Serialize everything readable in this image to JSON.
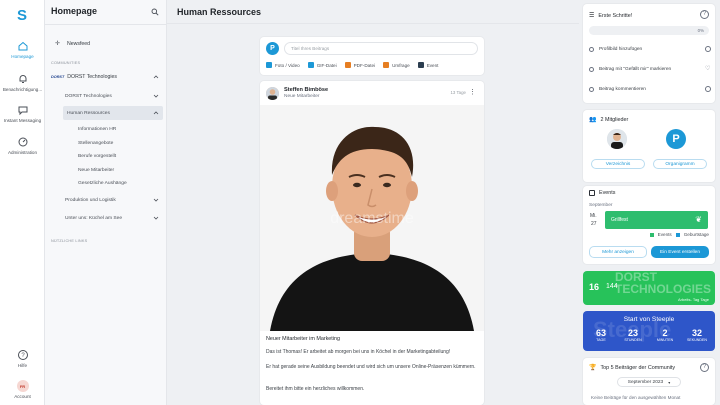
{
  "rail": {
    "logo": "S",
    "items": [
      {
        "label": "Homepage"
      },
      {
        "label": "Benachrichtigung..."
      },
      {
        "label": "Instant Messaging"
      },
      {
        "label": "Administration"
      }
    ],
    "help": "Hilfe",
    "account": "Account",
    "account_initials": "FR"
  },
  "sidebar": {
    "title": "Homepage",
    "newsfeed": "Newsfeed",
    "section_communities": "COMMUNITIES",
    "community_logo": "DORST",
    "community": "DORST Technologies",
    "items": [
      {
        "label": "DORST Technologies"
      },
      {
        "label": "Human Ressources"
      }
    ],
    "hr_children": [
      "Informationen HR",
      "Stellenangebote",
      "Berufe vorgestellt",
      "Neue Mitarbeiter",
      "Gesetzliche Aushänge"
    ],
    "more_items": [
      {
        "label": "Produktion und Logistik"
      },
      {
        "label": "Unter uns: Küchel am See"
      }
    ],
    "section_links": "NÜTZLICHE LINKS"
  },
  "header": {
    "title": "Human Ressources"
  },
  "composer": {
    "avatar": "P",
    "placeholder": "Titel Ihres Beitrags",
    "actions": [
      {
        "label": "Foto / Video",
        "color": "#1c98d6"
      },
      {
        "label": "GIF-Datei",
        "color": "#1c98d6"
      },
      {
        "label": "PDF-Datei",
        "color": "#e67e22"
      },
      {
        "label": "Umfrage",
        "color": "#e67e22"
      },
      {
        "label": "Event",
        "color": "#2c3e50"
      }
    ]
  },
  "post": {
    "author": "Steffen Bimböse",
    "role": "Neue Mitarbeiter",
    "time": "13 Tage",
    "watermark": "dreamstime",
    "title": "Neuer Mitarbeiter im Marketing",
    "lines": [
      "Das ist Thomas! Er arbeitet ab morgen bei uns in Köchel in der Marketingabteilung!",
      "Er hat gerade seine Ausbildung beendet und wird sich um unsere Online-Präsenzen kümmern.",
      "Bereitet ihm bitte ein herzliches willkommen."
    ]
  },
  "steps": {
    "title": "Erste Schritte!",
    "progress": "0%",
    "items": [
      "Profilbild hinzufügen",
      "Beitrag mit \"Gefällt mir\" markieren",
      "Beitrag kommentieren"
    ]
  },
  "members": {
    "title": "2 Mitglieder",
    "avatar_p": "P",
    "btn_dir": "Verzeichnis",
    "btn_org": "Organigramm"
  },
  "events": {
    "title": "Events",
    "month": "September",
    "day_name": "Mi.",
    "day_num": "27",
    "event_name": "Grillfest",
    "legend_events": "Events",
    "legend_birthdays": "Geburtstage",
    "btn_more": "Mehr anzeigen",
    "btn_create": "Ein Event erstellen"
  },
  "banner1": {
    "a": "16",
    "b": "144",
    "caption": "Arbeits- Tag Tage",
    "bg_text": "DORST TECHNOLOGIES"
  },
  "countdown": {
    "title": "Start von Steeple",
    "bg_text": "Steeple",
    "values": [
      {
        "n": "63",
        "l": "TAGE"
      },
      {
        "n": "23",
        "l": "STUNDEN"
      },
      {
        "n": "2",
        "l": "MINUTEN"
      },
      {
        "n": "32",
        "l": "SEKUNDEN"
      }
    ]
  },
  "top5": {
    "title": "Top 5 Beiträger der Community",
    "month": "September 2023",
    "empty": "Keine Beiträge für den ausgewählten Monat"
  },
  "colors": {
    "accent": "#1c98d6",
    "green": "#27ae60",
    "countdown": "#2e56c9"
  }
}
